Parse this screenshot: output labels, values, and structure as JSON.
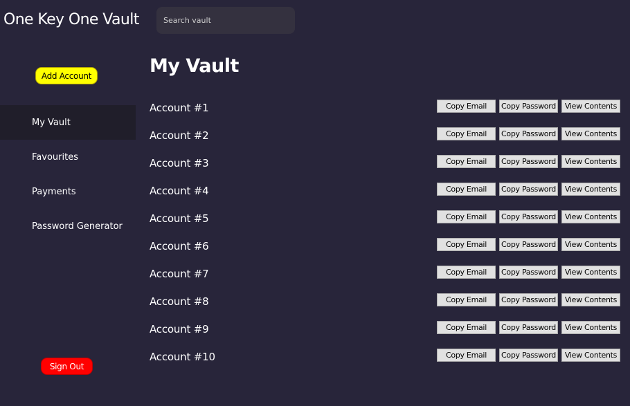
{
  "app": {
    "title": "One Key One Vault"
  },
  "search": {
    "placeholder": "Search vault",
    "value": ""
  },
  "sidebar": {
    "add_account_label": "Add Account",
    "items": [
      {
        "label": "My Vault",
        "active": true
      },
      {
        "label": "Favourites",
        "active": false
      },
      {
        "label": "Payments",
        "active": false
      },
      {
        "label": "Password Generator",
        "active": false
      }
    ],
    "sign_out_label": "Sign Out"
  },
  "main": {
    "title": "My Vault",
    "actions": {
      "copy_email": "Copy Email",
      "copy_password": "Copy Password",
      "view_contents": "View Contents"
    },
    "accounts": [
      {
        "name": "Account #1"
      },
      {
        "name": "Account #2"
      },
      {
        "name": "Account #3"
      },
      {
        "name": "Account #4"
      },
      {
        "name": "Account #5"
      },
      {
        "name": "Account #6"
      },
      {
        "name": "Account #7"
      },
      {
        "name": "Account #8"
      },
      {
        "name": "Account #9"
      },
      {
        "name": "Account #10"
      }
    ]
  },
  "colors": {
    "background": "#28253a",
    "sidebar_active": "#201e2a",
    "search_bg": "#34313f",
    "add_button": "#ffff00",
    "sign_out_button": "#ff0000",
    "action_button": "#e1e1e1"
  }
}
